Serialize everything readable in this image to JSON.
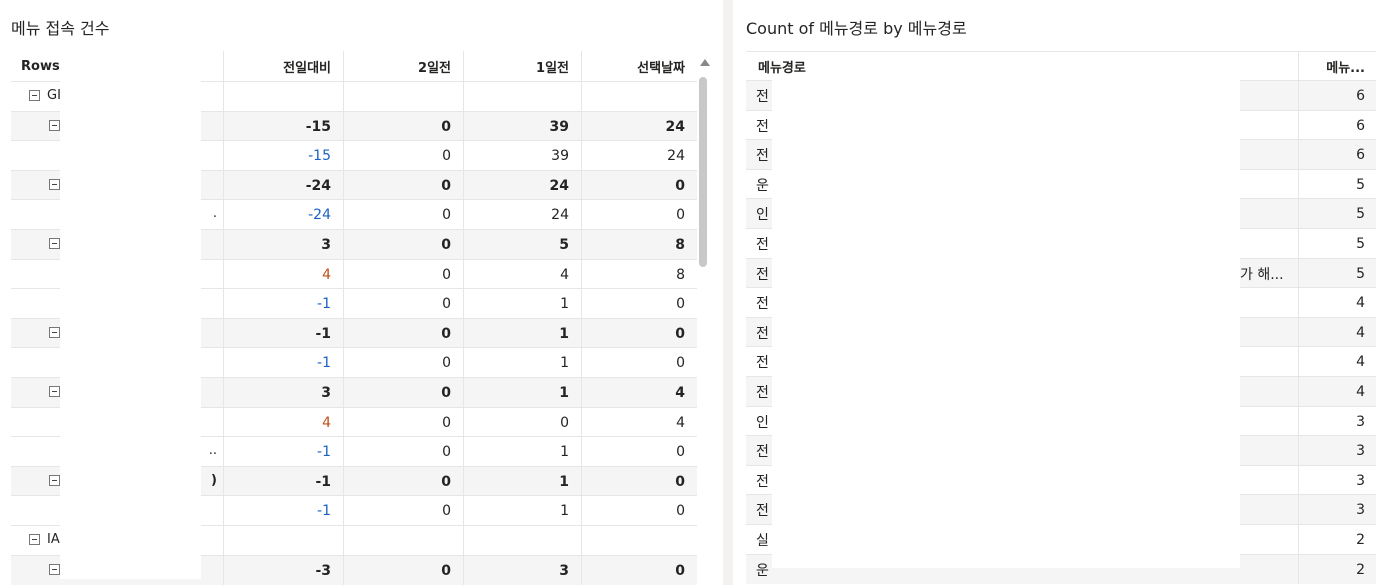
{
  "left": {
    "title": "메뉴 접속 건수",
    "rows_header": "Rows",
    "columns": [
      "전일대비",
      "2일전",
      "1일전",
      "선택날짜"
    ],
    "rows": [
      {
        "label": "GI",
        "expand": true,
        "indent": 0,
        "bold": false,
        "shaded": false,
        "values": [
          "",
          "",
          "",
          ""
        ],
        "tone": ""
      },
      {
        "label": "",
        "expand": true,
        "indent": 1,
        "bold": true,
        "shaded": true,
        "values": [
          "-15",
          "0",
          "39",
          "24"
        ],
        "tone": ""
      },
      {
        "label": "",
        "expand": false,
        "indent": 2,
        "bold": false,
        "shaded": false,
        "values": [
          "-15",
          "0",
          "39",
          "24"
        ],
        "tone": "neg"
      },
      {
        "label": "",
        "expand": true,
        "indent": 1,
        "bold": true,
        "shaded": true,
        "values": [
          "-24",
          "0",
          "24",
          "0"
        ],
        "tone": ""
      },
      {
        "label": "",
        "expand": false,
        "indent": 2,
        "bold": false,
        "shaded": false,
        "values": [
          "-24",
          "0",
          "24",
          "0"
        ],
        "tone": "neg",
        "trail": "."
      },
      {
        "label": "",
        "expand": true,
        "indent": 1,
        "bold": true,
        "shaded": true,
        "values": [
          "3",
          "0",
          "5",
          "8"
        ],
        "tone": ""
      },
      {
        "label": "",
        "expand": false,
        "indent": 2,
        "bold": false,
        "shaded": false,
        "values": [
          "4",
          "0",
          "4",
          "8"
        ],
        "tone": "pos"
      },
      {
        "label": "",
        "expand": false,
        "indent": 2,
        "bold": false,
        "shaded": false,
        "values": [
          "-1",
          "0",
          "1",
          "0"
        ],
        "tone": "neg"
      },
      {
        "label": "",
        "expand": true,
        "indent": 1,
        "bold": true,
        "shaded": true,
        "values": [
          "-1",
          "0",
          "1",
          "0"
        ],
        "tone": ""
      },
      {
        "label": "",
        "expand": false,
        "indent": 2,
        "bold": false,
        "shaded": false,
        "values": [
          "-1",
          "0",
          "1",
          "0"
        ],
        "tone": "neg"
      },
      {
        "label": "",
        "expand": true,
        "indent": 1,
        "bold": true,
        "shaded": true,
        "values": [
          "3",
          "0",
          "1",
          "4"
        ],
        "tone": ""
      },
      {
        "label": "",
        "expand": false,
        "indent": 2,
        "bold": false,
        "shaded": false,
        "values": [
          "4",
          "0",
          "0",
          "4"
        ],
        "tone": "pos"
      },
      {
        "label": "",
        "expand": false,
        "indent": 2,
        "bold": false,
        "shaded": false,
        "values": [
          "-1",
          "0",
          "1",
          "0"
        ],
        "tone": "neg",
        "trail": ".."
      },
      {
        "label": "",
        "expand": true,
        "indent": 1,
        "bold": true,
        "shaded": true,
        "values": [
          "-1",
          "0",
          "1",
          "0"
        ],
        "tone": "",
        "trail": ")"
      },
      {
        "label": "",
        "expand": false,
        "indent": 2,
        "bold": false,
        "shaded": false,
        "values": [
          "-1",
          "0",
          "1",
          "0"
        ],
        "tone": "neg"
      },
      {
        "label": "IA",
        "expand": true,
        "indent": 0,
        "bold": false,
        "shaded": false,
        "values": [
          "",
          "",
          "",
          ""
        ],
        "tone": ""
      },
      {
        "label": "",
        "expand": true,
        "indent": 1,
        "bold": true,
        "shaded": true,
        "values": [
          "-3",
          "0",
          "3",
          "0"
        ],
        "tone": ""
      }
    ]
  },
  "right": {
    "title": "Count of 메뉴경로 by 메뉴경로",
    "columns": [
      "메뉴경로",
      "메뉴..."
    ],
    "rows": [
      {
        "path": "전",
        "count": "6",
        "tail": ""
      },
      {
        "path": "전",
        "count": "6",
        "tail": ""
      },
      {
        "path": "전",
        "count": "6",
        "tail": ""
      },
      {
        "path": "운",
        "count": "5",
        "tail": ""
      },
      {
        "path": "인",
        "count": "5",
        "tail": ""
      },
      {
        "path": "전",
        "count": "5",
        "tail": ""
      },
      {
        "path": "전",
        "count": "5",
        "tail": "가 해..."
      },
      {
        "path": "전",
        "count": "4",
        "tail": ""
      },
      {
        "path": "전",
        "count": "4",
        "tail": ""
      },
      {
        "path": "전",
        "count": "4",
        "tail": ""
      },
      {
        "path": "전",
        "count": "4",
        "tail": ""
      },
      {
        "path": "인",
        "count": "3",
        "tail": ""
      },
      {
        "path": "전",
        "count": "3",
        "tail": ""
      },
      {
        "path": "전",
        "count": "3",
        "tail": ""
      },
      {
        "path": "전",
        "count": "3",
        "tail": ""
      },
      {
        "path": "실",
        "count": "2",
        "tail": ""
      },
      {
        "path": "운",
        "count": "2",
        "tail": ""
      }
    ]
  }
}
